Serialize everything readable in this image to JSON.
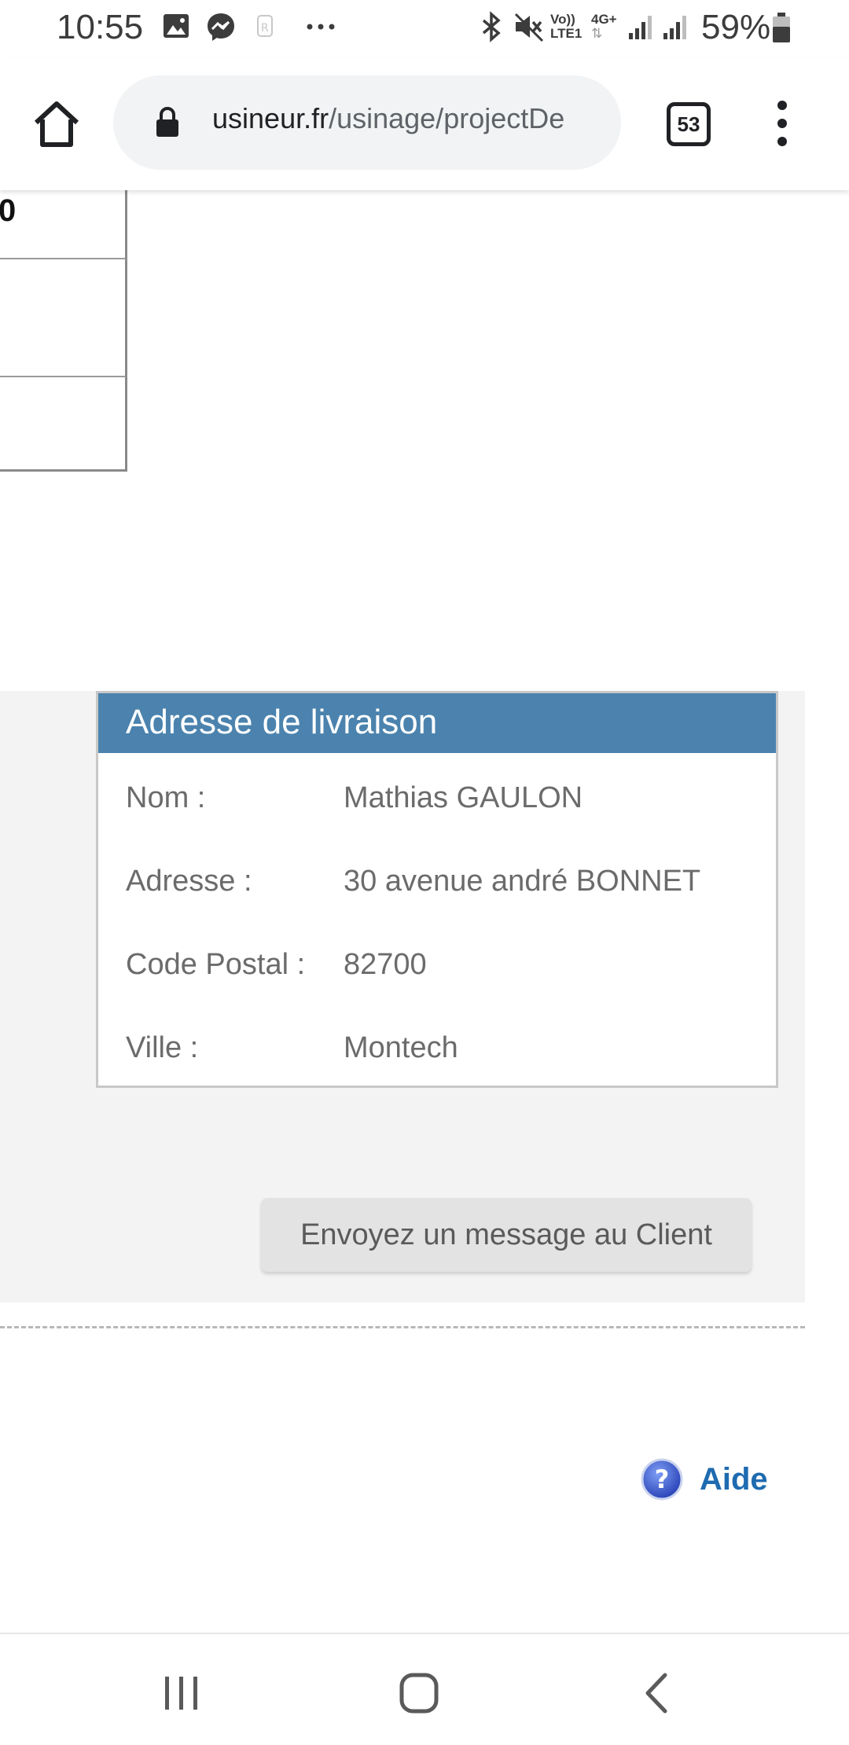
{
  "status_bar": {
    "time": "10:55",
    "battery": "59%",
    "icons": [
      "gallery-icon",
      "messenger-icon",
      "app-icon",
      "more-dots-icon",
      "bluetooth-icon",
      "mute-icon",
      "volte-icon",
      "4g-icon",
      "signal-icon",
      "battery-icon"
    ],
    "network_top": "Vo))",
    "network_bottom": "LTE1",
    "network_type": "4G+"
  },
  "browser": {
    "url_host": "usineur.fr",
    "url_path": "/usinage/projectDe",
    "tab_count": "53"
  },
  "table_fragment": {
    "cell_value": "0"
  },
  "delivery": {
    "title": "Adresse de livraison",
    "rows": [
      {
        "label": "Nom :",
        "value": "Mathias GAULON"
      },
      {
        "label": "Adresse :",
        "value": "30 avenue andré BONNET"
      },
      {
        "label": "Code Postal :",
        "value": "82700"
      },
      {
        "label": "Ville :",
        "value": "Montech"
      }
    ],
    "header_color": "#4b83ae"
  },
  "actions": {
    "message_button": "Envoyez un message au Client",
    "help_label": "Aide"
  },
  "colors": {
    "link": "#1e6bb0",
    "panel_bg": "#f3f3f3"
  }
}
